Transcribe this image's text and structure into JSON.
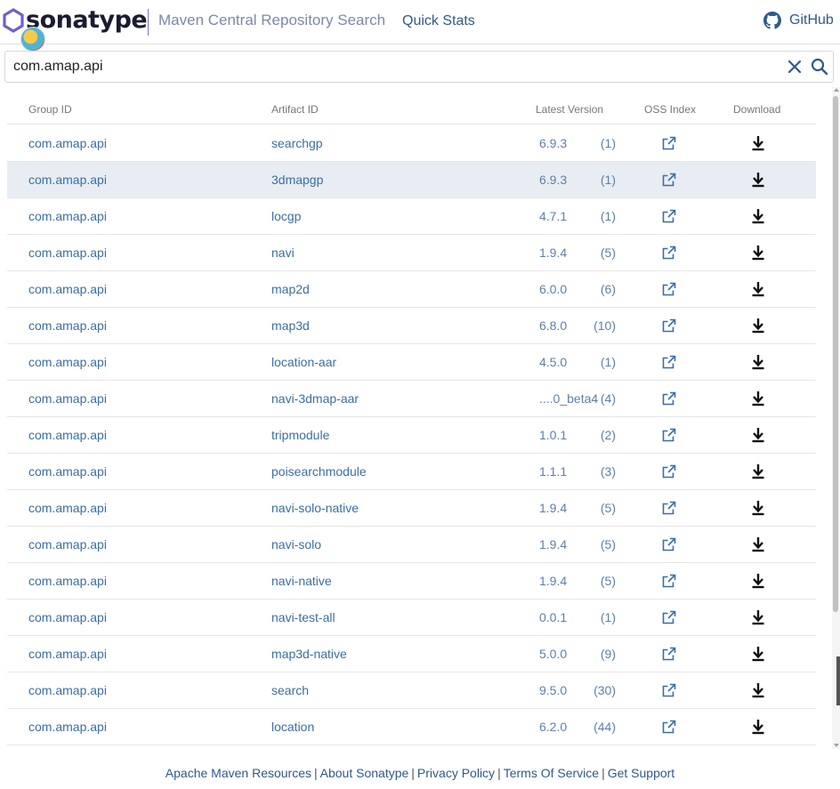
{
  "header": {
    "brand": "sonatype",
    "app_title": "Maven Central Repository Search",
    "quick_stats": "Quick Stats",
    "github": "GitHub"
  },
  "search": {
    "value": "com.amap.api",
    "placeholder": ""
  },
  "table": {
    "columns": [
      "Group ID",
      "Artifact ID",
      "Latest Version",
      "OSS Index",
      "Download"
    ],
    "rows": [
      {
        "group": "com.amap.api",
        "artifact": "searchgp",
        "version": "6.9.3",
        "count": "(1)"
      },
      {
        "group": "com.amap.api",
        "artifact": "3dmapgp",
        "version": "6.9.3",
        "count": "(1)"
      },
      {
        "group": "com.amap.api",
        "artifact": "locgp",
        "version": "4.7.1",
        "count": "(1)"
      },
      {
        "group": "com.amap.api",
        "artifact": "navi",
        "version": "1.9.4",
        "count": "(5)"
      },
      {
        "group": "com.amap.api",
        "artifact": "map2d",
        "version": "6.0.0",
        "count": "(6)"
      },
      {
        "group": "com.amap.api",
        "artifact": "map3d",
        "version": "6.8.0",
        "count": "(10)"
      },
      {
        "group": "com.amap.api",
        "artifact": "location-aar",
        "version": "4.5.0",
        "count": "(1)"
      },
      {
        "group": "com.amap.api",
        "artifact": "navi-3dmap-aar",
        "version": "....0_beta4",
        "count": "(4)"
      },
      {
        "group": "com.amap.api",
        "artifact": "tripmodule",
        "version": "1.0.1",
        "count": "(2)"
      },
      {
        "group": "com.amap.api",
        "artifact": "poisearchmodule",
        "version": "1.1.1",
        "count": "(3)"
      },
      {
        "group": "com.amap.api",
        "artifact": "navi-solo-native",
        "version": "1.9.4",
        "count": "(5)"
      },
      {
        "group": "com.amap.api",
        "artifact": "navi-solo",
        "version": "1.9.4",
        "count": "(5)"
      },
      {
        "group": "com.amap.api",
        "artifact": "navi-native",
        "version": "1.9.4",
        "count": "(5)"
      },
      {
        "group": "com.amap.api",
        "artifact": "navi-test-all",
        "version": "0.0.1",
        "count": "(1)"
      },
      {
        "group": "com.amap.api",
        "artifact": "map3d-native",
        "version": "5.0.0",
        "count": "(9)"
      },
      {
        "group": "com.amap.api",
        "artifact": "search",
        "version": "9.5.0",
        "count": "(30)"
      },
      {
        "group": "com.amap.api",
        "artifact": "location",
        "version": "6.2.0",
        "count": "(44)"
      }
    ],
    "highlighted_row": 1
  },
  "footer": {
    "links": [
      "Apache Maven Resources",
      "About Sonatype",
      "Privacy Policy",
      "Terms Of Service",
      "Get Support"
    ]
  },
  "colors": {
    "brand_purple": "#6e5fd1",
    "link_blue": "#3a6ea5",
    "row_highlight": "#e8edf3"
  },
  "icons": {
    "oss_index": "external-link-icon",
    "download": "download-icon",
    "clear": "close-icon",
    "search": "search-icon",
    "github": "github-icon"
  }
}
